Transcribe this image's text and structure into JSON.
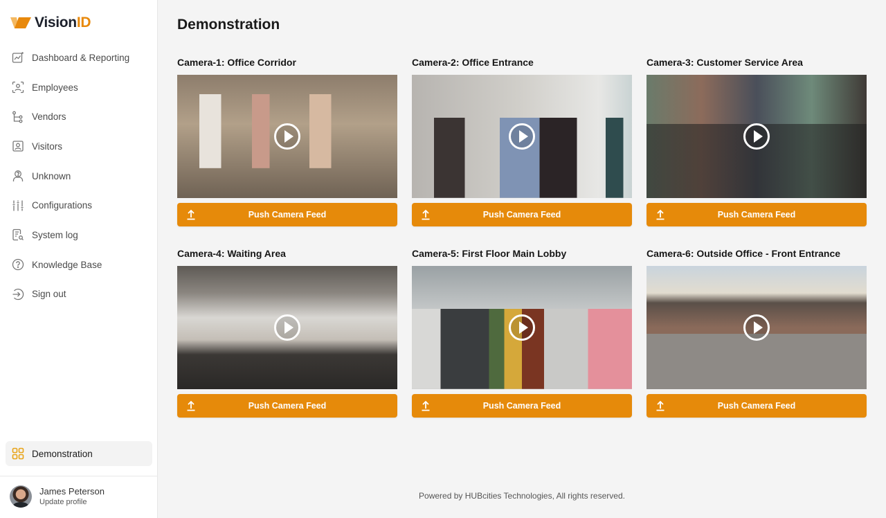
{
  "brand": {
    "name_main": "Vision",
    "name_accent": "ID",
    "accent_color": "#e8890c"
  },
  "sidebar": {
    "items": [
      {
        "label": "Dashboard & Reporting",
        "icon": "chart-icon"
      },
      {
        "label": "Employees",
        "icon": "face-scan-icon"
      },
      {
        "label": "Vendors",
        "icon": "hierarchy-icon"
      },
      {
        "label": "Visitors",
        "icon": "id-badge-icon"
      },
      {
        "label": "Unknown",
        "icon": "unknown-user-icon"
      },
      {
        "label": "Configurations",
        "icon": "sliders-icon"
      },
      {
        "label": "System log",
        "icon": "log-search-icon"
      },
      {
        "label": "Knowledge Base",
        "icon": "help-circle-icon"
      },
      {
        "label": "Sign out",
        "icon": "sign-out-icon"
      }
    ],
    "active_item": {
      "label": "Demonstration",
      "icon": "grid-icon"
    },
    "profile": {
      "name": "James Peterson",
      "action": "Update profile"
    }
  },
  "main": {
    "title": "Demonstration",
    "cameras": [
      {
        "title": "Camera-1: Office Corridor",
        "button": "Push Camera Feed"
      },
      {
        "title": "Camera-2: Office Entrance",
        "button": "Push Camera Feed"
      },
      {
        "title": "Camera-3: Customer Service Area",
        "button": "Push Camera Feed"
      },
      {
        "title": "Camera-4: Waiting Area",
        "button": "Push Camera Feed"
      },
      {
        "title": "Camera-5: First Floor Main Lobby",
        "button": "Push Camera Feed"
      },
      {
        "title": "Camera-6: Outside Office - Front Entrance",
        "button": "Push Camera Feed"
      }
    ],
    "button_color": "#e68a0a"
  },
  "footer": {
    "text": "Powered by HUBcities Technologies, All rights reserved."
  }
}
